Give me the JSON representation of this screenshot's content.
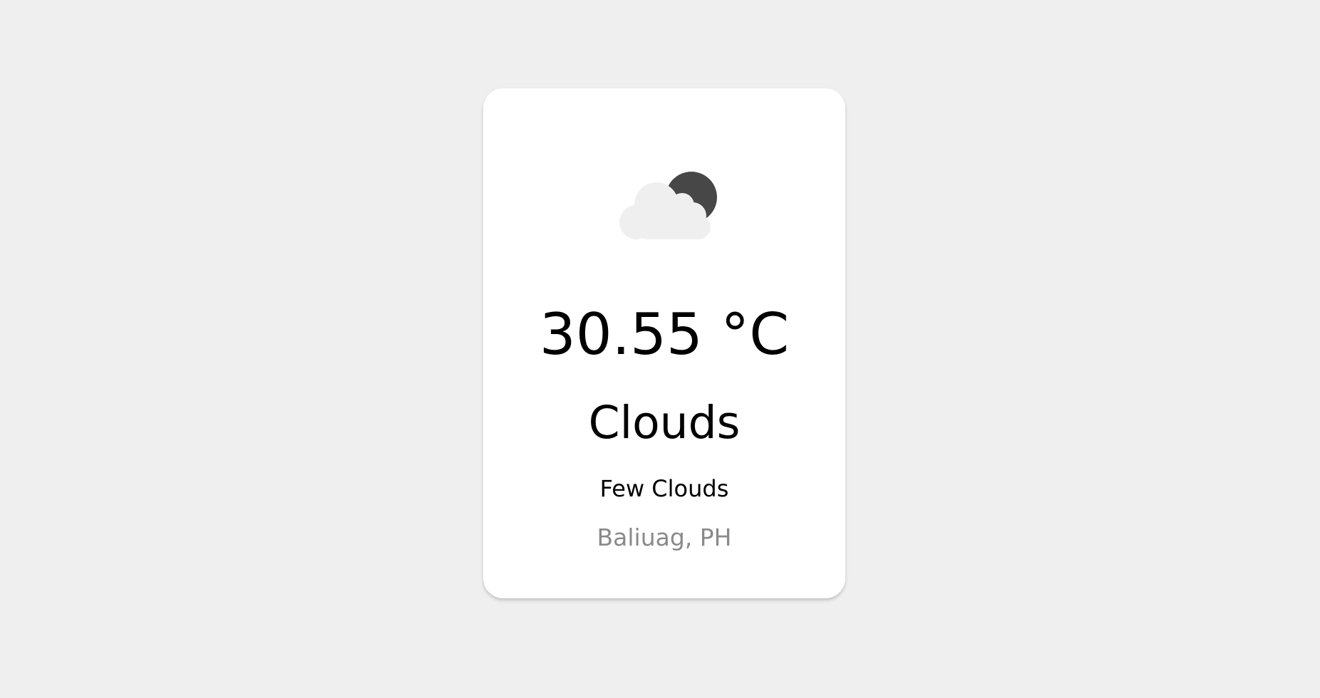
{
  "weather": {
    "icon": "cloud-moon-icon",
    "temperature": "30.55 °C",
    "condition": "Clouds",
    "description": "Few Clouds",
    "location": "Baliuag, PH"
  },
  "colors": {
    "background": "#efefef",
    "card": "#ffffff",
    "moon": "#474747",
    "cloud": "#efefef",
    "primary_text": "#000000",
    "secondary_text": "#8a8a8a"
  }
}
